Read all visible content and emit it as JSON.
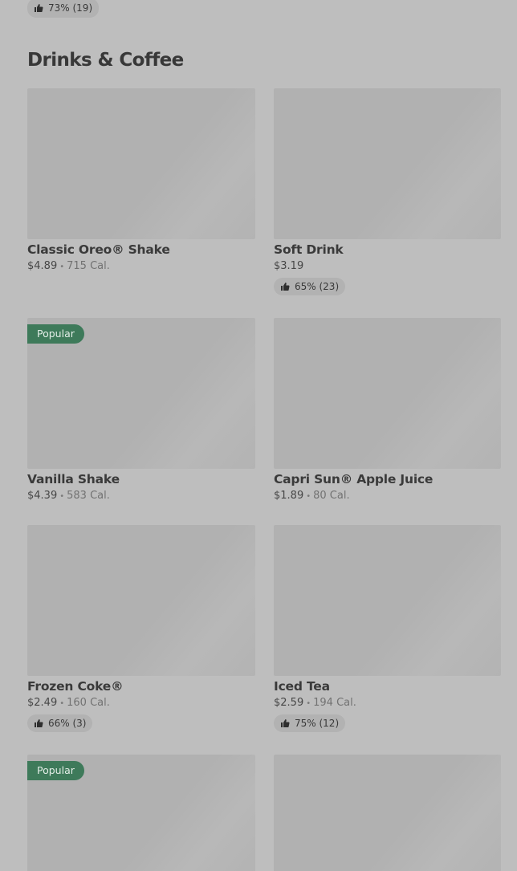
{
  "top_rating": {
    "icon": "thumbs-up-icon",
    "text": "73% (19)"
  },
  "section": {
    "title": "Drinks & Coffee"
  },
  "badges": {
    "popular": "Popular"
  },
  "colors": {
    "background": "#bebebe",
    "thumbnail": "#b1b1b1",
    "popular_badge": "#3e7a5a",
    "rating_pill": "#b2b2b2"
  },
  "items": [
    {
      "name": "Classic Oreo® Shake",
      "price": "$4.89",
      "calories": "715 Cal.",
      "rating": "",
      "popular": false
    },
    {
      "name": "Soft Drink",
      "price": "$3.19",
      "calories": "",
      "rating": "65% (23)",
      "popular": false
    },
    {
      "name": "Vanilla Shake",
      "price": "$4.39",
      "calories": "583 Cal.",
      "rating": "",
      "popular": true
    },
    {
      "name": "Capri Sun® Apple Juice",
      "price": "$1.89",
      "calories": "80 Cal.",
      "rating": "",
      "popular": false
    },
    {
      "name": "Frozen Coke®",
      "price": "$2.49",
      "calories": "160 Cal.",
      "rating": "66% (3)",
      "popular": false
    },
    {
      "name": "Iced Tea",
      "price": "$2.59",
      "calories": "194 Cal.",
      "rating": "75% (12)",
      "popular": false
    },
    {
      "name": "",
      "price": "",
      "calories": "",
      "rating": "",
      "popular": true
    },
    {
      "name": "",
      "price": "",
      "calories": "",
      "rating": "",
      "popular": false
    }
  ]
}
